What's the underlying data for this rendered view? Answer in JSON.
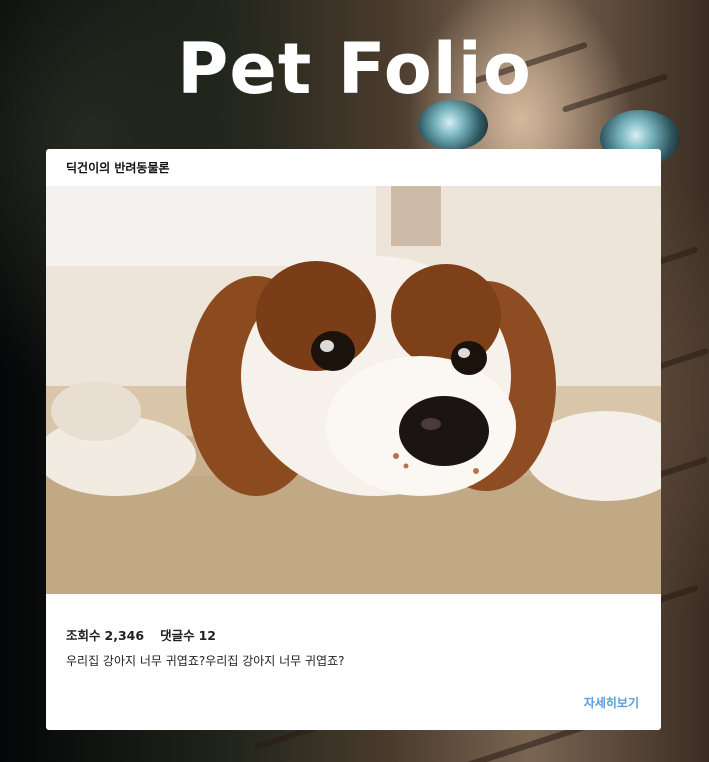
{
  "site": {
    "title": "Pet Folio"
  },
  "card": {
    "header_title": "딕건이의 반려동물론",
    "image_alt": "dog-photo",
    "stats": {
      "views_label": "조회수",
      "views_value": "2,346",
      "comments_label": "댓글수",
      "comments_value": "12"
    },
    "description": "우리집 강아지 너무 귀엽죠?우리집 강아지 너무 귀엽죠?",
    "more_label": "자세히보기"
  },
  "colors": {
    "title": "#ffffff",
    "card_bg": "#ffffff",
    "link": "#5b9bd6",
    "text": "#222222"
  }
}
